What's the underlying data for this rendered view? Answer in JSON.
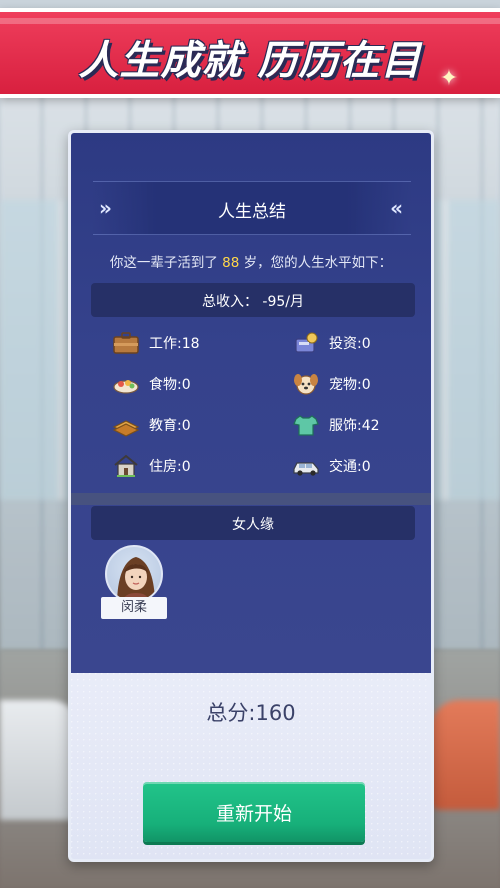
{
  "banner": {
    "title": "人生成就 历历在目"
  },
  "summary": {
    "header_title": "人生总结",
    "line_prefix": "你这一辈子活到了 ",
    "age": "88",
    "line_suffix": " 岁，您的人生水平如下：",
    "income": "总收入：  -95/月"
  },
  "stats": {
    "work": "工作:18",
    "investment": "投资:0",
    "food": "食物:0",
    "pet": "宠物:0",
    "education": "教育:0",
    "clothing": "服饰:42",
    "housing": "住房:0",
    "transport": "交通:0"
  },
  "relationships": {
    "title": "女人缘",
    "people": [
      {
        "name": "闵柔"
      }
    ]
  },
  "footer": {
    "total_score": "总分:160",
    "restart_label": "重新开始"
  },
  "colors": {
    "banner_red": "#e3304e",
    "panel_blue": "#323f88",
    "age_highlight": "#ffd84a",
    "button_green": "#1cb87f"
  }
}
